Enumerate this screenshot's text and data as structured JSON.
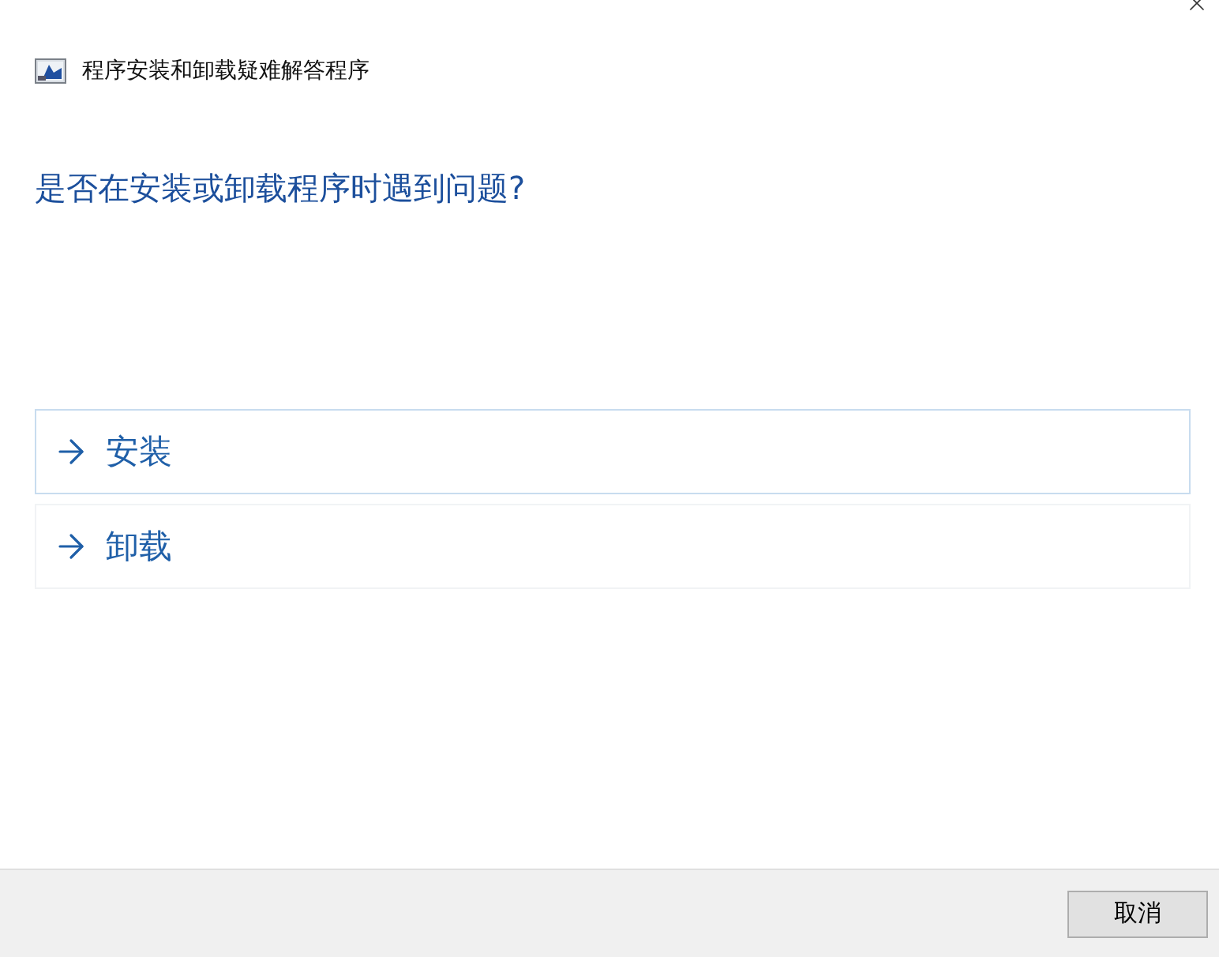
{
  "window": {
    "title": "程序安装和卸载疑难解答程序"
  },
  "heading": "是否在安装或卸载程序时遇到问题?",
  "options": [
    {
      "label": "安装",
      "selected": true
    },
    {
      "label": "卸载",
      "selected": false
    }
  ],
  "buttons": [
    "取消"
  ]
}
